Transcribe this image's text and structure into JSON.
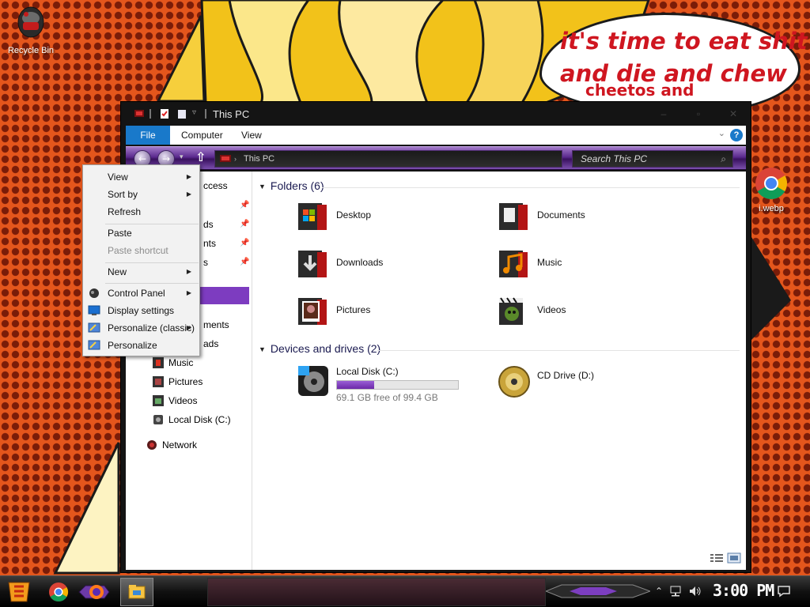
{
  "desktop": {
    "icons": [
      {
        "label": "Recycle Bin"
      },
      {
        "label": "i.webp"
      }
    ],
    "speech_bubble": {
      "line1": "it's time to eat shit",
      "line2": "and die and chew",
      "line3": "cheetos and"
    }
  },
  "window": {
    "title": "This PC",
    "ribbon_tabs": [
      "File",
      "Computer",
      "View"
    ],
    "help_glyph": "?",
    "address": "This PC",
    "search_placeholder": "Search This PC",
    "nav_pane": {
      "partial_items": [
        "ccess",
        "ds",
        "nts",
        "s",
        "ments",
        "ads"
      ],
      "items": [
        "Music",
        "Pictures",
        "Videos",
        "Local Disk (C:)",
        "Network"
      ]
    },
    "folders_group": {
      "title": "Folders (6)",
      "items": [
        "Desktop",
        "Documents",
        "Downloads",
        "Music",
        "Pictures",
        "Videos"
      ]
    },
    "drives_group": {
      "title": "Devices and drives (2)",
      "drives": [
        {
          "label": "Local Disk (C:)",
          "free_text": "69.1 GB free of 99.4 GB",
          "used_fraction": 0.305
        },
        {
          "label": "CD Drive (D:)"
        }
      ]
    }
  },
  "context_menu": {
    "items": [
      {
        "label": "View",
        "submenu": true,
        "disabled": false
      },
      {
        "label": "Sort by",
        "submenu": true,
        "disabled": false
      },
      {
        "label": "Refresh",
        "submenu": false,
        "disabled": false
      },
      {
        "label": "Paste",
        "submenu": false,
        "disabled": false
      },
      {
        "label": "Paste shortcut",
        "submenu": false,
        "disabled": true
      },
      {
        "label": "New",
        "submenu": true,
        "disabled": false
      },
      {
        "label": "Control Panel",
        "submenu": true,
        "disabled": false
      },
      {
        "label": "Display settings",
        "submenu": false,
        "disabled": false
      },
      {
        "label": "Personalize (classic)",
        "submenu": true,
        "disabled": false
      },
      {
        "label": "Personalize",
        "submenu": false,
        "disabled": false
      }
    ],
    "arrow_glyph": "▶"
  },
  "taskbar": {
    "clock": "3:00 PM"
  },
  "colors": {
    "accent_purple": "#7d3cc0",
    "file_tab_blue": "#1979ca",
    "speech_red": "#cf1620",
    "desktop_orange": "#e4561c"
  },
  "icons": {
    "start": "start-icon",
    "browser_chrome": "chrome-icon",
    "browser_firefox": "firefox-icon",
    "file_explorer": "folder-icon"
  }
}
